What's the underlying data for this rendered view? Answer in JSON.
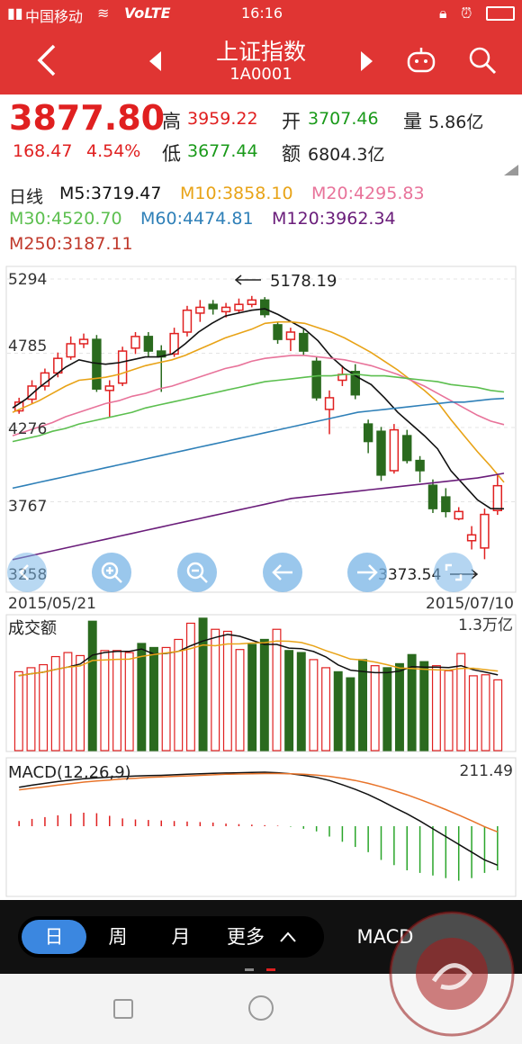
{
  "status": {
    "carrier": "中国移动",
    "network": "VoLTE",
    "time": "16:16"
  },
  "header": {
    "title": "上证指数",
    "code": "1A0001"
  },
  "quote": {
    "price": "3877.80",
    "change": "168.47",
    "change_pct": "4.54%",
    "high_label": "高",
    "high": "3959.22",
    "low_label": "低",
    "low": "3677.44",
    "open_label": "开",
    "open": "3707.46",
    "amount_label": "额",
    "amount": "6804.3亿",
    "volume_label": "量",
    "volume": "5.86亿"
  },
  "ma": {
    "period": "日线",
    "m5": "M5:3719.47",
    "m10": "M10:3858.10",
    "m20": "M20:4295.83",
    "m30": "M30:4520.70",
    "m60": "M60:4474.81",
    "m120": "M120:3962.34",
    "m250": "M250:3187.11"
  },
  "colors": {
    "up": "#e02020",
    "down": "#2a6a1e",
    "m5": "#111111",
    "m10": "#e8a317",
    "m20": "#e8739a",
    "m30": "#5cbf4f",
    "m60": "#2f80b8",
    "m120": "#6a1d7a",
    "header": "#e03533"
  },
  "chart_data": {
    "type": "candlestick",
    "y_ticks": [
      "5294",
      "4785",
      "4276",
      "3767",
      "3258"
    ],
    "ylim": [
      3258,
      5294
    ],
    "x_start": "2015/05/21",
    "x_end": "2015/07/10",
    "max_annotation": "5178.19",
    "min_annotation": "3373.54",
    "candles": [
      {
        "o": 4390,
        "c": 4450,
        "h": 4480,
        "l": 4370
      },
      {
        "o": 4470,
        "c": 4560,
        "h": 4600,
        "l": 4440
      },
      {
        "o": 4560,
        "c": 4650,
        "h": 4680,
        "l": 4530
      },
      {
        "o": 4650,
        "c": 4750,
        "h": 4790,
        "l": 4620
      },
      {
        "o": 4760,
        "c": 4850,
        "h": 4900,
        "l": 4740
      },
      {
        "o": 4850,
        "c": 4880,
        "h": 4920,
        "l": 4820
      },
      {
        "o": 4880,
        "c": 4540,
        "h": 4910,
        "l": 4520
      },
      {
        "o": 4530,
        "c": 4560,
        "h": 4600,
        "l": 4350
      },
      {
        "o": 4580,
        "c": 4800,
        "h": 4830,
        "l": 4560
      },
      {
        "o": 4820,
        "c": 4900,
        "h": 4930,
        "l": 4780
      },
      {
        "o": 4900,
        "c": 4800,
        "h": 4930,
        "l": 4760
      },
      {
        "o": 4800,
        "c": 4760,
        "h": 4840,
        "l": 4520
      },
      {
        "o": 4780,
        "c": 4920,
        "h": 4960,
        "l": 4760
      },
      {
        "o": 4930,
        "c": 5080,
        "h": 5110,
        "l": 4900
      },
      {
        "o": 5060,
        "c": 5100,
        "h": 5150,
        "l": 5000
      },
      {
        "o": 5120,
        "c": 5090,
        "h": 5150,
        "l": 5050
      },
      {
        "o": 5070,
        "c": 5100,
        "h": 5130,
        "l": 5030
      },
      {
        "o": 5080,
        "c": 5120,
        "h": 5160,
        "l": 5060
      },
      {
        "o": 5120,
        "c": 5150,
        "h": 5178,
        "l": 5100
      },
      {
        "o": 5150,
        "c": 5050,
        "h": 5170,
        "l": 5030
      },
      {
        "o": 4980,
        "c": 4880,
        "h": 5000,
        "l": 4850
      },
      {
        "o": 4880,
        "c": 4930,
        "h": 4960,
        "l": 4800
      },
      {
        "o": 4920,
        "c": 4800,
        "h": 4950,
        "l": 4770
      },
      {
        "o": 4730,
        "c": 4480,
        "h": 4760,
        "l": 4460
      },
      {
        "o": 4400,
        "c": 4480,
        "h": 4530,
        "l": 4230
      },
      {
        "o": 4600,
        "c": 4640,
        "h": 4700,
        "l": 4560
      },
      {
        "o": 4660,
        "c": 4500,
        "h": 4710,
        "l": 4470
      },
      {
        "o": 4300,
        "c": 4180,
        "h": 4330,
        "l": 4100
      },
      {
        "o": 4250,
        "c": 3950,
        "h": 4280,
        "l": 3910
      },
      {
        "o": 3980,
        "c": 4260,
        "h": 4300,
        "l": 3960
      },
      {
        "o": 4220,
        "c": 4050,
        "h": 4260,
        "l": 4030
      },
      {
        "o": 4050,
        "c": 3980,
        "h": 4080,
        "l": 3900
      },
      {
        "o": 3880,
        "c": 3720,
        "h": 3920,
        "l": 3690
      },
      {
        "o": 3800,
        "c": 3700,
        "h": 3860,
        "l": 3660
      },
      {
        "o": 3650,
        "c": 3700,
        "h": 3730,
        "l": 3640
      },
      {
        "o": 3500,
        "c": 3540,
        "h": 3600,
        "l": 3440
      },
      {
        "o": 3450,
        "c": 3680,
        "h": 3720,
        "l": 3373
      },
      {
        "o": 3707,
        "c": 3877,
        "h": 3959,
        "l": 3677
      }
    ],
    "ma_series": [
      {
        "name": "M5",
        "color": "#111111",
        "values": [
          4410,
          4470,
          4550,
          4620,
          4690,
          4740,
          4720,
          4710,
          4720,
          4740,
          4760,
          4760,
          4780,
          4850,
          4930,
          4990,
          5040,
          5060,
          5080,
          5090,
          5050,
          5000,
          4950,
          4870,
          4760,
          4680,
          4620,
          4570,
          4480,
          4380,
          4300,
          4220,
          4130,
          3980,
          3880,
          3780,
          3720,
          3719
        ]
      },
      {
        "name": "M10",
        "color": "#e8a317",
        "values": [
          4380,
          4420,
          4460,
          4510,
          4560,
          4600,
          4610,
          4620,
          4640,
          4670,
          4700,
          4720,
          4740,
          4770,
          4810,
          4850,
          4890,
          4920,
          4950,
          4990,
          5000,
          5000,
          4990,
          4960,
          4930,
          4890,
          4840,
          4790,
          4730,
          4670,
          4600,
          4530,
          4450,
          4330,
          4220,
          4110,
          4010,
          3900
        ]
      },
      {
        "name": "M20",
        "color": "#e8739a",
        "values": [
          4220,
          4250,
          4280,
          4310,
          4350,
          4380,
          4410,
          4440,
          4460,
          4490,
          4510,
          4540,
          4560,
          4590,
          4620,
          4650,
          4680,
          4700,
          4730,
          4750,
          4760,
          4770,
          4770,
          4760,
          4750,
          4740,
          4720,
          4700,
          4670,
          4640,
          4600,
          4560,
          4510,
          4460,
          4410,
          4360,
          4320,
          4296
        ]
      },
      {
        "name": "M30",
        "color": "#5cbf4f",
        "values": [
          4180,
          4200,
          4220,
          4250,
          4270,
          4300,
          4320,
          4340,
          4360,
          4380,
          4410,
          4430,
          4450,
          4470,
          4490,
          4510,
          4530,
          4550,
          4570,
          4590,
          4600,
          4610,
          4620,
          4630,
          4630,
          4640,
          4640,
          4630,
          4630,
          4620,
          4610,
          4600,
          4590,
          4570,
          4560,
          4550,
          4530,
          4520
        ]
      },
      {
        "name": "M60",
        "color": "#2f80b8",
        "values": [
          3860,
          3880,
          3900,
          3920,
          3940,
          3960,
          3980,
          4000,
          4020,
          4040,
          4060,
          4080,
          4100,
          4120,
          4140,
          4160,
          4180,
          4200,
          4220,
          4240,
          4260,
          4280,
          4300,
          4320,
          4340,
          4360,
          4380,
          4390,
          4400,
          4410,
          4420,
          4430,
          4440,
          4450,
          4450,
          4460,
          4470,
          4475
        ]
      },
      {
        "name": "M120",
        "color": "#6a1d7a",
        "values": [
          3370,
          3390,
          3410,
          3430,
          3450,
          3470,
          3490,
          3510,
          3530,
          3550,
          3570,
          3590,
          3610,
          3630,
          3650,
          3670,
          3690,
          3710,
          3730,
          3750,
          3770,
          3790,
          3800,
          3810,
          3820,
          3830,
          3840,
          3850,
          3860,
          3870,
          3880,
          3890,
          3900,
          3910,
          3920,
          3930,
          3945,
          3962
        ]
      }
    ],
    "volume": {
      "label": "成交额",
      "max_label": "1.3万亿",
      "ylim": [
        0,
        1.3
      ],
      "values": [
        0.78,
        0.82,
        0.85,
        0.93,
        0.97,
        0.94,
        1.28,
        0.99,
        0.99,
        0.97,
        1.06,
        1.02,
        1.02,
        1.1,
        1.26,
        1.31,
        1.2,
        1.18,
        1.0,
        1.05,
        1.1,
        1.2,
        0.99,
        0.97,
        0.9,
        0.82,
        0.78,
        0.72,
        0.9,
        0.84,
        0.82,
        0.86,
        0.95,
        0.88,
        0.84,
        0.79,
        0.96,
        0.74,
        0.75,
        0.7
      ]
    },
    "macd": {
      "label": "MACD(12,26,9)",
      "max_label": "211.49",
      "dif": [
        150,
        158,
        165,
        172,
        178,
        183,
        186,
        189,
        191,
        193,
        195,
        196,
        198,
        200,
        202,
        204,
        205,
        206,
        207,
        208,
        206,
        202,
        196,
        188,
        176,
        160,
        142,
        122,
        98,
        72,
        48,
        20,
        -10,
        -40,
        -70,
        -100,
        -130,
        -150
      ],
      "dea": [
        140,
        146,
        152,
        158,
        164,
        170,
        174,
        178,
        182,
        185,
        188,
        190,
        192,
        194,
        196,
        198,
        200,
        201,
        202,
        203,
        203,
        202,
        200,
        197,
        192,
        185,
        176,
        165,
        152,
        137,
        121,
        103,
        84,
        64,
        43,
        21,
        -2,
        -22
      ],
      "hist": [
        20,
        28,
        35,
        42,
        48,
        52,
        50,
        40,
        30,
        26,
        24,
        22,
        20,
        18,
        16,
        14,
        10,
        8,
        6,
        4,
        2,
        -2,
        -10,
        -20,
        -40,
        -60,
        -80,
        -100,
        -130,
        -150,
        -170,
        -180,
        -190,
        -200,
        -210,
        -200,
        -180,
        -170
      ]
    }
  },
  "period_tabs": {
    "day": "日",
    "week": "周",
    "month": "月",
    "more": "更多",
    "indicator": "MACD"
  }
}
